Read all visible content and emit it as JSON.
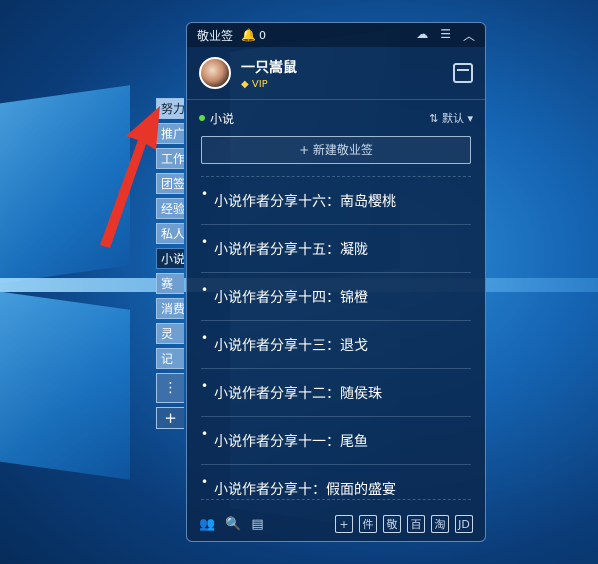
{
  "app": {
    "title": "敬业签",
    "notif_count": "0"
  },
  "user": {
    "name": "一只嵩鼠",
    "vip": "VIP"
  },
  "category": {
    "name": "小说",
    "sort_label": "默认"
  },
  "new_button": "+ 新建敬业签",
  "tabs": [
    {
      "label": "努力",
      "style": "light"
    },
    {
      "label": "推广",
      "style": ""
    },
    {
      "label": "工作",
      "style": ""
    },
    {
      "label": "团签",
      "style": ""
    },
    {
      "label": "经验",
      "style": ""
    },
    {
      "label": "私人",
      "style": ""
    },
    {
      "label": "小说",
      "style": "active"
    },
    {
      "label": "赛",
      "style": ""
    },
    {
      "label": "消费",
      "style": ""
    },
    {
      "label": "灵",
      "style": ""
    },
    {
      "label": "记",
      "style": ""
    }
  ],
  "tab_more": "⋮",
  "tab_add": "+",
  "items": [
    "小说作者分享十六：南岛樱桃",
    "小说作者分享十五：凝陇",
    "小说作者分享十四：锦橙",
    "小说作者分享十三：退戈",
    "小说作者分享十二：随侯珠",
    "小说作者分享十一：尾鱼",
    "小说作者分享十：假面的盛宴"
  ],
  "bottom_buttons": [
    "+",
    "件",
    "敬",
    "百",
    "淘",
    "JD"
  ],
  "colors": {
    "panel_bg": "#0a284e",
    "vip": "#ffd24a",
    "dot": "#5fdc4a",
    "arrow": "#e8352a"
  },
  "icons": {
    "bell": "bell-icon",
    "cloud": "cloud-icon",
    "menu": "menu-icon",
    "collapse": "chevron-up-icon",
    "calendar": "calendar-icon",
    "users": "users-icon",
    "search": "search-icon",
    "notes": "notes-icon"
  }
}
